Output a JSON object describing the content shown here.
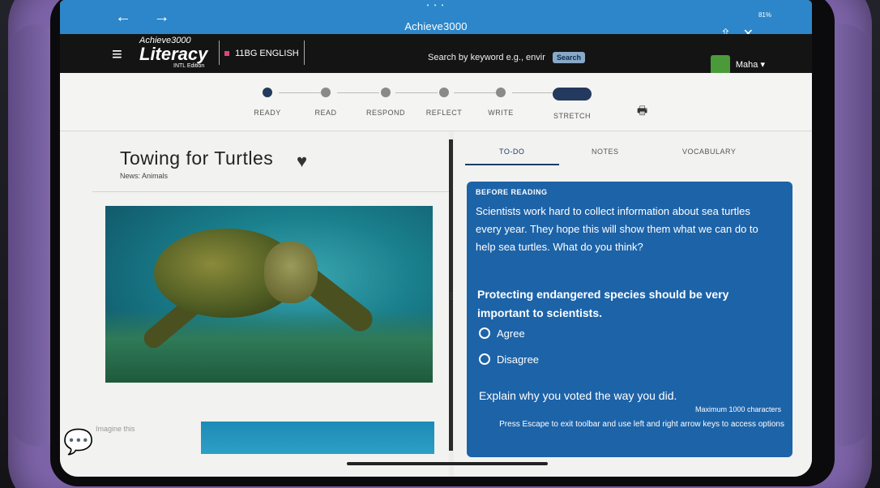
{
  "browser": {
    "title": "Achieve3000",
    "back_icon": "←",
    "forward_icon": "→",
    "status": "81%",
    "share_icon": "⇧",
    "close_icon": "✕"
  },
  "header": {
    "brand_top": "Achieve3000",
    "brand_main": "Literacy",
    "brand_edition": "INTL Edition",
    "class_name": "11BG ENGLISH",
    "search_placeholder": "Search by keyword e.g., envir",
    "search_button": "Search",
    "user_name": "Maha",
    "user_caret": "▾"
  },
  "steps": [
    {
      "label": "READY"
    },
    {
      "label": "READ"
    },
    {
      "label": "RESPOND"
    },
    {
      "label": "REFLECT"
    },
    {
      "label": "WRITE"
    },
    {
      "label": "STRETCH"
    }
  ],
  "article": {
    "title": "Towing for Turtles",
    "category": "News: Animals",
    "caption_faint": "Imagine this"
  },
  "tabs": {
    "todo": "TO-DO",
    "notes": "NOTES",
    "vocabulary": "VOCABULARY"
  },
  "poll": {
    "kicker": "BEFORE READING",
    "intro": "Scientists work hard to collect information about sea turtles every year. They hope this will show them what we can do to help sea turtles. What do you think?",
    "question": "Protecting endangered species should be very important to scientists.",
    "option_agree": "Agree",
    "option_disagree": "Disagree",
    "explain_prompt": "Explain why you voted the way you did.",
    "max_chars": "Maximum 1000 characters",
    "escape_hint": "Press Escape to exit toolbar and use left and right arrow keys to access options"
  },
  "colors": {
    "browser_bar": "#2c86c9",
    "app_header": "#141414",
    "poll_card": "#1d63a8",
    "active_step": "#233a5e",
    "case": "#7d63a8"
  }
}
